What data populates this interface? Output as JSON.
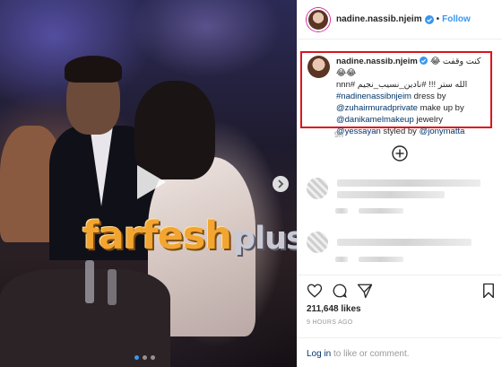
{
  "post": {
    "username": "nadine.nassib.njeim",
    "separator": "•",
    "follow_label": "Follow"
  },
  "caption": {
    "username": "nadine.nassib.njeim",
    "arabic_line1": "كنت وقفت 😂😂😂",
    "arabic_line2": "الله ستر !!! #نادين_نسيب_نجيم #nnn",
    "tag": "#nadinenassibnjeim",
    "dress_by": " dress by",
    "designer": "@zuhairmuradprivate",
    "makeup_by": " make up by",
    "makeup_artist": "@danikamelmakeup",
    "jewelry": " jewelry",
    "jeweler": "@yessayan",
    "styled_by": " styled by ",
    "stylist": "@jonymatta",
    "time": "9h"
  },
  "stats": {
    "likes": "211,648 likes",
    "time_ago": "9 HOURS AGO"
  },
  "footer": {
    "login": "Log in",
    "rest": " to like or comment."
  },
  "watermark": {
    "part1": "farfesh",
    "part2": "plus.com"
  },
  "carousel": {
    "slides": 3,
    "active_index": 0
  },
  "icons": [
    "verified-icon",
    "play-icon",
    "chevron-right-icon",
    "add-circle-icon",
    "heart-icon",
    "comment-icon",
    "share-icon",
    "bookmark-icon"
  ],
  "colors": {
    "link": "#3897f0",
    "caption_link": "#003569",
    "highlight_box": "#d9171e"
  }
}
